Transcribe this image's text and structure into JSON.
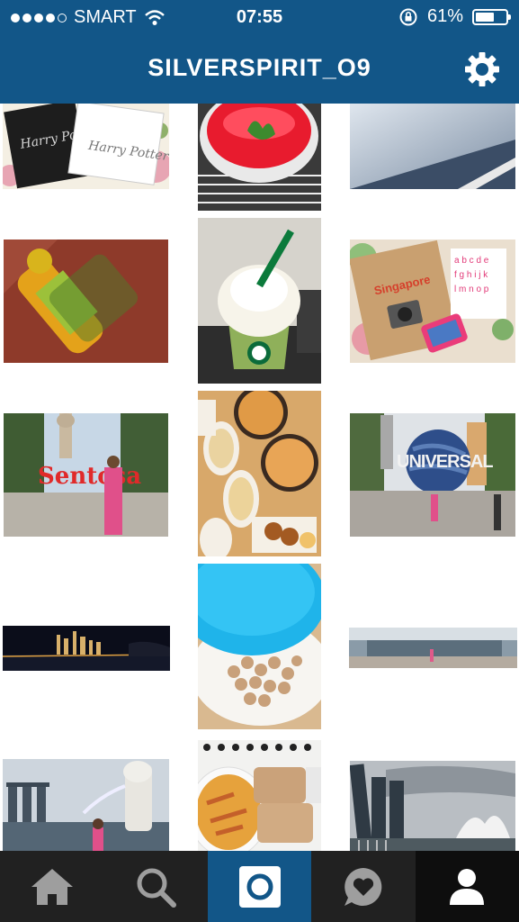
{
  "status_bar": {
    "carrier": "SMART",
    "time": "07:55",
    "battery_text": "61%",
    "battery_level": 0.61
  },
  "header": {
    "title": "SILVERSPIRIT_O9",
    "settings_icon": "gear-icon"
  },
  "colors": {
    "brand_blue": "#125688",
    "tabbar_dark": "#212121",
    "icon_grey": "#9e9e9e"
  },
  "tabs": [
    {
      "name": "home",
      "icon": "home-icon"
    },
    {
      "name": "search",
      "icon": "search-icon"
    },
    {
      "name": "camera",
      "icon": "camera-icon",
      "active": true
    },
    {
      "name": "activity",
      "icon": "heart-bubble-icon"
    },
    {
      "name": "profile",
      "icon": "person-icon"
    }
  ],
  "grid": {
    "photos": [
      {
        "name": "photo-harry-potter-tickets"
      },
      {
        "name": "photo-red-jelly-dessert"
      },
      {
        "name": "photo-sky-window"
      },
      {
        "name": "photo-mango-juice-bottle"
      },
      {
        "name": "photo-starbucks-frappuccino"
      },
      {
        "name": "photo-singapore-notebook"
      },
      {
        "name": "photo-sentosa-merlion"
      },
      {
        "name": "photo-food-platter"
      },
      {
        "name": "photo-universal-globe"
      },
      {
        "name": "photo-marina-bay-night-panorama"
      },
      {
        "name": "photo-tupperware-snack"
      },
      {
        "name": "photo-mall-panorama"
      },
      {
        "name": "photo-merlion-marina-bay-sands"
      },
      {
        "name": "photo-pasta-bread"
      },
      {
        "name": "photo-artscience-museum"
      }
    ]
  },
  "logos": {
    "sentosa_sign": "Sentosa",
    "universal_globe": "UNIVERSAL",
    "notebook": "Singapore"
  }
}
